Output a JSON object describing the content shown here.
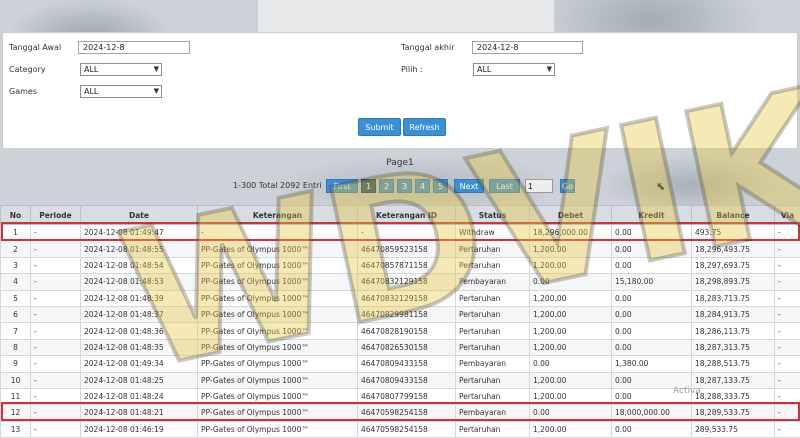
{
  "filters": {
    "start_date_label": "Tanggal Awal",
    "start_date_value": "2024-12-8",
    "end_date_label": "Tanggal akhir",
    "end_date_value": "2024-12-8",
    "category_label": "Category",
    "category_value": "ALL",
    "pilih_label": "Pilih  :",
    "pilih_value": "ALL",
    "games_label": "Games",
    "games_value": "ALL",
    "submit_label": "Submit",
    "refresh_label": "Refresh"
  },
  "pager": {
    "title": "Page1",
    "info": "1-300 Total 2092 Entri",
    "first": "First",
    "pages": [
      "1",
      "2",
      "3",
      "4",
      "5"
    ],
    "next": "Next",
    "last": "Last",
    "input_value": "1",
    "go": "Go"
  },
  "table": {
    "headers": [
      "No",
      "Periode",
      "Date",
      "Keterangan",
      "Keterangan ID",
      "Status",
      "Debet",
      "Kredit",
      "Balance",
      "Via"
    ],
    "rows": [
      [
        "1",
        "-",
        "2024-12-08 01:49:47",
        "-",
        "-",
        "Withdraw",
        "18,296,000.00",
        "0.00",
        "493.75",
        "-"
      ],
      [
        "2",
        "-",
        "2024-12-08 01:48:55",
        "PP-Gates of Olympus 1000™",
        "46470859523158",
        "Pertaruhan",
        "1,200.00",
        "0.00",
        "18,296,493.75",
        "-"
      ],
      [
        "3",
        "-",
        "2024-12-08 01:48:54",
        "PP-Gates of Olympus 1000™",
        "46470857871158",
        "Pertaruhan",
        "1,200.00",
        "0.00",
        "18,297,693.75",
        "-"
      ],
      [
        "4",
        "-",
        "2024-12-08 01:48:53",
        "PP-Gates of Olympus 1000™",
        "46470832129158",
        "Pembayaran",
        "0.00",
        "15,180.00",
        "18,298,893.75",
        "-"
      ],
      [
        "5",
        "-",
        "2024-12-08 01:48:39",
        "PP-Gates of Olympus 1000™",
        "46470832129158",
        "Pertaruhan",
        "1,200.00",
        "0.00",
        "18,283,713.75",
        "-"
      ],
      [
        "6",
        "-",
        "2024-12-08 01:48:37",
        "PP-Gates of Olympus 1000™",
        "46470829981158",
        "Pertaruhan",
        "1,200.00",
        "0.00",
        "18,284,913.75",
        "-"
      ],
      [
        "7",
        "-",
        "2024-12-08 01:48:36",
        "PP-Gates of Olympus 1000™",
        "46470828190158",
        "Pertaruhan",
        "1,200.00",
        "0.00",
        "18,286,113.75",
        "-"
      ],
      [
        "8",
        "-",
        "2024-12-08 01:48:35",
        "PP-Gates of Olympus 1000™",
        "46470826530158",
        "Pertaruhan",
        "1,200.00",
        "0.00",
        "18,287,313.75",
        "-"
      ],
      [
        "9",
        "-",
        "2024-12-08 01:49:34",
        "PP-Gates of Olympus 1000™",
        "46470809433158",
        "Pembayaran",
        "0.00",
        "1,380.00",
        "18,288,513.75",
        "-"
      ],
      [
        "10",
        "-",
        "2024-12-08 01:48:25",
        "PP-Gates of Olympus 1000™",
        "46470809433158",
        "Pertaruhan",
        "1,200.00",
        "0.00",
        "18,287,133.75",
        "-"
      ],
      [
        "11",
        "-",
        "2024-12-08 01:48:24",
        "PP-Gates of Olympus 1000™",
        "46470807799158",
        "Pertaruhan",
        "1,200.00",
        "0.00",
        "18,288,333.75",
        "-"
      ],
      [
        "12",
        "-",
        "2024-12-08 01:48:21",
        "PP-Gates of Olympus 1000™",
        "46470598254158",
        "Pembayaran",
        "0.00",
        "18,000,000.00",
        "18,289,533.75",
        "-"
      ],
      [
        "13",
        "-",
        "2024-12-08 01:46:19",
        "PP-Gates of Olympus 1000™",
        "46470598254158",
        "Pertaruhan",
        "1,200.00",
        "0.00",
        "289,533.75",
        "-"
      ]
    ]
  },
  "highlighted_rows": [
    "1",
    "12"
  ],
  "watermark_text": "WDVIK",
  "activate_text": "Activa",
  "colors": {
    "accent_blue": "#3b8fd6",
    "highlight_red": "#d0323a",
    "link_blue": "#2d7ec4"
  }
}
